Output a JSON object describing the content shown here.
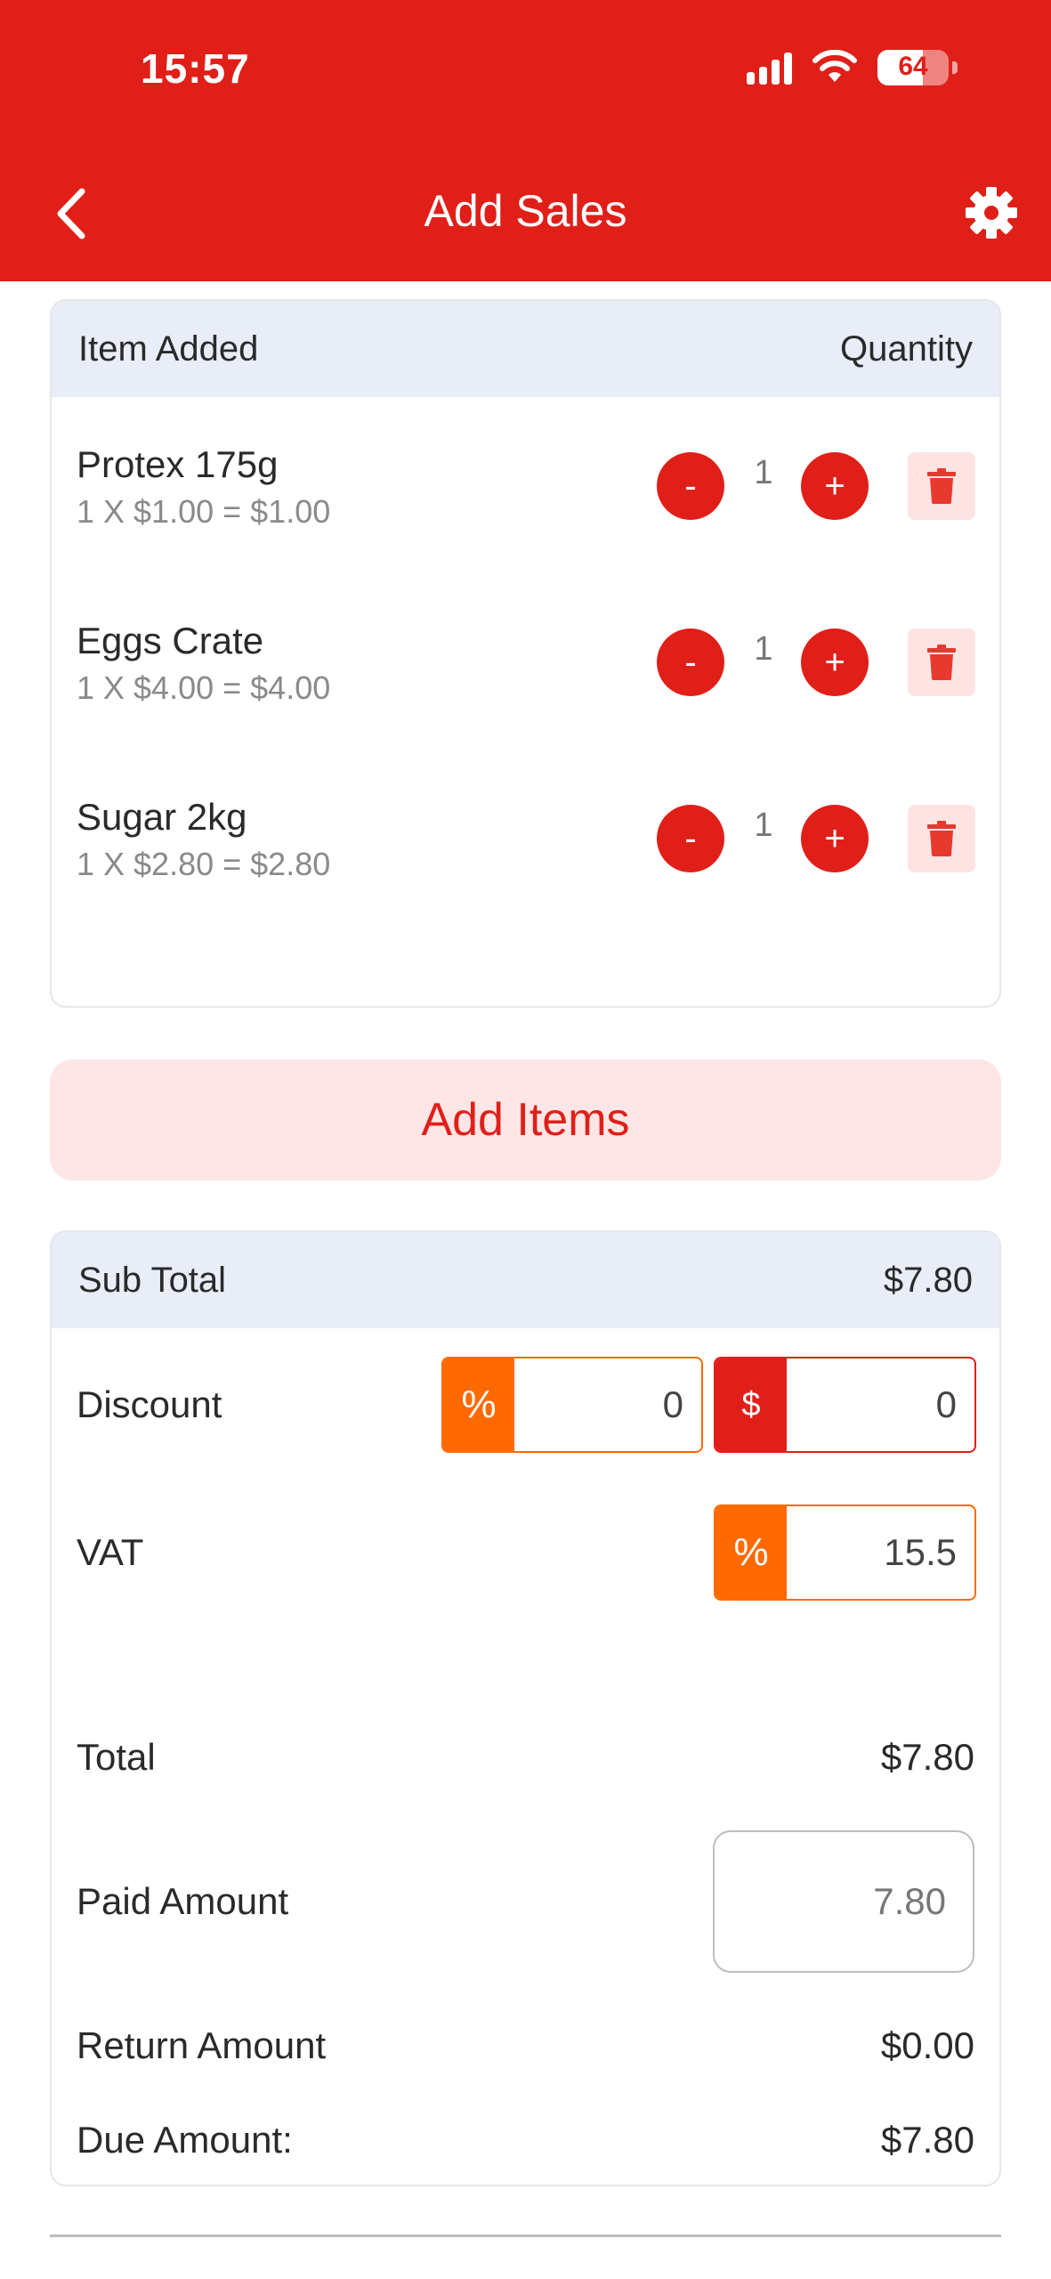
{
  "status_bar": {
    "time": "15:57",
    "battery": "64"
  },
  "nav": {
    "title": "Add Sales"
  },
  "items_table": {
    "header_item": "Item Added",
    "header_quantity": "Quantity",
    "items": [
      {
        "name": "Protex 175g",
        "calc": "1 X $1.00 = $1.00",
        "qty": "1"
      },
      {
        "name": "Eggs Crate",
        "calc": "1 X $4.00 = $4.00",
        "qty": "1"
      },
      {
        "name": "Sugar 2kg",
        "calc": "1 X $2.80 = $2.80",
        "qty": "1"
      }
    ],
    "minus_label": "-",
    "plus_label": "+"
  },
  "add_items_label": "Add Items",
  "summary": {
    "subtotal_label": "Sub Total",
    "subtotal_value": "$7.80",
    "discount_label": "Discount",
    "discount_percent_symbol": "%",
    "discount_percent_value": "0",
    "discount_amount_symbol": "$",
    "discount_amount_value": "0",
    "vat_label": "VAT",
    "vat_symbol": "%",
    "vat_value": "15.5",
    "total_label": "Total",
    "total_value": "$7.80",
    "paid_label": "Paid Amount",
    "paid_value": "7.80",
    "return_label": "Return Amount",
    "return_value": "$0.00",
    "due_label": "Due Amount:",
    "due_value": "$7.80"
  },
  "colors": {
    "brand_red": "#e01f19",
    "accent_orange": "#ff6a00",
    "header_bg": "#e8edf8",
    "soft_red": "#fde6e5"
  }
}
